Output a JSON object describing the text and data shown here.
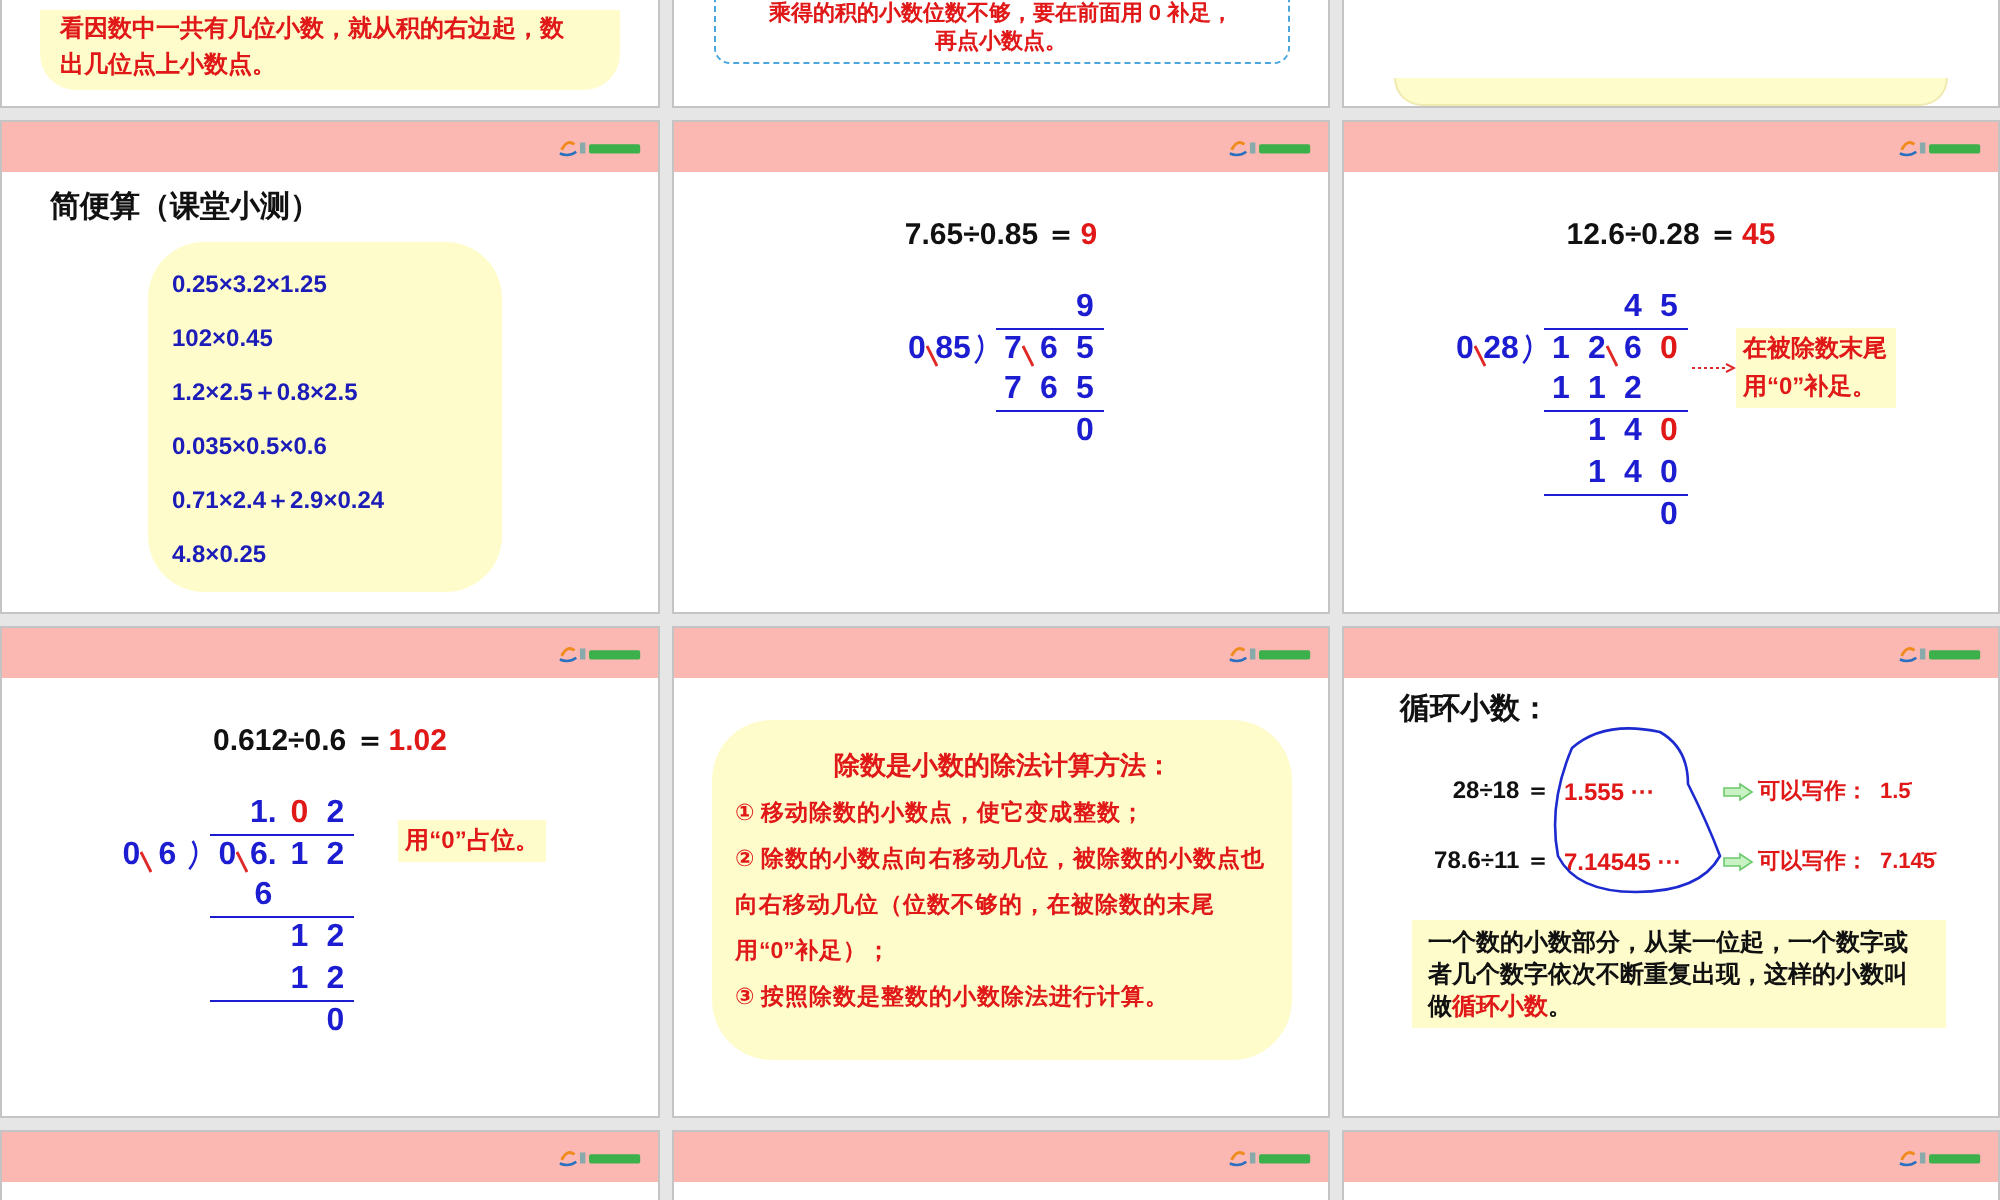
{
  "slide_rows": [
    {
      "slides": [
        {
          "kind": "note",
          "dashed_border": false,
          "lines": [
            "看因数中一共有几位小数，就从积的右边起，数",
            "出几位点上小数点。"
          ]
        },
        {
          "kind": "note",
          "dashed_border": true,
          "lines": [
            "乘得的积的小数位数不够，要在前面用 0 补足，",
            "再点小数点。"
          ]
        },
        {
          "kind": "note",
          "dashed_border": false
        }
      ]
    },
    {
      "slides": [
        {
          "kind": "practice",
          "title": "简便算（课堂小测）",
          "items": [
            "0.25×3.2×1.25",
            "102×0.45",
            "1.2×2.5＋0.8×2.5",
            "0.035×0.5×0.6",
            "0.71×2.4＋2.9×0.24",
            "4.8×0.25"
          ]
        },
        {
          "kind": "division",
          "equation": {
            "expression": "7.65÷0.85 ＝",
            "answer": "9"
          },
          "division": {
            "divisor": [
              {
                "t": "0",
                "struck": true
              },
              {
                "t": "85",
                "struck": false
              }
            ],
            "quotient": [
              {
                "kind": "blank"
              },
              {
                "kind": "blank"
              },
              {
                "kind": "digit",
                "t": "9",
                "highlight": false
              }
            ],
            "dividend": [
              {
                "t": "7",
                "struck": true,
                "highlight": false
              },
              {
                "t": "6",
                "struck": false,
                "highlight": false
              },
              {
                "t": "5",
                "struck": false,
                "highlight": false
              }
            ],
            "steps": [
              {
                "cells": [
                  {
                    "kind": "digit",
                    "t": "7",
                    "highlight": false
                  },
                  {
                    "kind": "digit",
                    "t": "6",
                    "highlight": false
                  },
                  {
                    "kind": "digit",
                    "t": "5",
                    "highlight": false
                  }
                ],
                "rule": true
              },
              {
                "cells": [
                  {
                    "kind": "blank"
                  },
                  {
                    "kind": "blank"
                  },
                  {
                    "kind": "digit",
                    "t": "0",
                    "highlight": false
                  }
                ],
                "rule": false
              }
            ]
          }
        },
        {
          "kind": "division",
          "equation": {
            "expression": "12.6÷0.28 ＝",
            "answer": "45"
          },
          "division": {
            "divisor": [
              {
                "t": "0",
                "struck": true
              },
              {
                "t": "28",
                "struck": false
              }
            ],
            "quotient": [
              {
                "kind": "blank"
              },
              {
                "kind": "blank"
              },
              {
                "kind": "digit",
                "t": "4",
                "highlight": false
              },
              {
                "kind": "digit",
                "t": "5",
                "highlight": false
              }
            ],
            "dividend": [
              {
                "t": "1",
                "struck": false,
                "highlight": false
              },
              {
                "t": "2",
                "struck": true,
                "highlight": false
              },
              {
                "t": "6",
                "struck": false,
                "highlight": false
              },
              {
                "t": "0",
                "struck": false,
                "highlight": true
              }
            ],
            "steps": [
              {
                "cells": [
                  {
                    "kind": "digit",
                    "t": "1",
                    "highlight": false
                  },
                  {
                    "kind": "digit",
                    "t": "1",
                    "highlight": false
                  },
                  {
                    "kind": "digit",
                    "t": "2",
                    "highlight": false
                  },
                  {
                    "kind": "blank"
                  }
                ],
                "rule": true
              },
              {
                "cells": [
                  {
                    "kind": "blank"
                  },
                  {
                    "kind": "digit",
                    "t": "1",
                    "highlight": false
                  },
                  {
                    "kind": "digit",
                    "t": "4",
                    "highlight": false
                  },
                  {
                    "kind": "digit",
                    "t": "0",
                    "highlight": true
                  }
                ],
                "rule": false
              },
              {
                "cells": [
                  {
                    "kind": "blank"
                  },
                  {
                    "kind": "digit",
                    "t": "1",
                    "highlight": false
                  },
                  {
                    "kind": "digit",
                    "t": "4",
                    "highlight": false
                  },
                  {
                    "kind": "digit",
                    "t": "0",
                    "highlight": false
                  }
                ],
                "rule": true
              },
              {
                "cells": [
                  {
                    "kind": "blank"
                  },
                  {
                    "kind": "blank"
                  },
                  {
                    "kind": "blank"
                  },
                  {
                    "kind": "digit",
                    "t": "0",
                    "highlight": false
                  }
                ],
                "rule": false
              }
            ]
          },
          "callout": {
            "lines": [
              "在被除数末尾",
              "用“0”补足。"
            ],
            "leader": true
          }
        }
      ]
    },
    {
      "slides": [
        {
          "kind": "division",
          "equation": {
            "expression": "0.612÷0.6 ＝",
            "answer": "1.02"
          },
          "division": {
            "divisor": [
              {
                "t": "0",
                "struck": true
              },
              {
                "t": "6",
                "struck": false
              }
            ],
            "quotient": [
              {
                "kind": "blank"
              },
              {
                "kind": "digit",
                "t": "1.",
                "highlight": false
              },
              {
                "kind": "digit",
                "t": "0",
                "highlight": true
              },
              {
                "kind": "digit",
                "t": "2",
                "highlight": false
              }
            ],
            "dividend": [
              {
                "t": "0",
                "struck": true,
                "highlight": false
              },
              {
                "t": "6.",
                "struck": false,
                "highlight": false
              },
              {
                "t": "1",
                "struck": false,
                "highlight": false
              },
              {
                "t": "2",
                "struck": false,
                "highlight": false
              }
            ],
            "steps": [
              {
                "cells": [
                  {
                    "kind": "blank"
                  },
                  {
                    "kind": "digit",
                    "t": "6",
                    "highlight": false
                  },
                  {
                    "kind": "blank"
                  },
                  {
                    "kind": "blank"
                  }
                ],
                "rule": true
              },
              {
                "cells": [
                  {
                    "kind": "blank"
                  },
                  {
                    "kind": "blank"
                  },
                  {
                    "kind": "digit",
                    "t": "1",
                    "highlight": false
                  },
                  {
                    "kind": "digit",
                    "t": "2",
                    "highlight": false
                  }
                ],
                "rule": false
              },
              {
                "cells": [
                  {
                    "kind": "blank"
                  },
                  {
                    "kind": "blank"
                  },
                  {
                    "kind": "digit",
                    "t": "1",
                    "highlight": false
                  },
                  {
                    "kind": "digit",
                    "t": "2",
                    "highlight": false
                  }
                ],
                "rule": true
              },
              {
                "cells": [
                  {
                    "kind": "blank"
                  },
                  {
                    "kind": "blank"
                  },
                  {
                    "kind": "blank"
                  },
                  {
                    "kind": "digit",
                    "t": "0",
                    "highlight": false
                  }
                ],
                "rule": false
              }
            ]
          },
          "callout": {
            "lines": [
              "用“0”占位。"
            ],
            "leader": false
          }
        },
        {
          "kind": "method",
          "title": "除数是小数的除法计算方法：",
          "items": [
            "① 移动除数的小数点，使它变成整数；",
            "② 除数的小数点向右移动几位，被除数的小数点也向右移动几位（位数不够的，在被除数的末尾用“0”补足）；",
            "③ 按照除数是整数的小数除法进行计算。"
          ]
        },
        {
          "kind": "repeating",
          "title": "循环小数：",
          "rows": [
            {
              "expression": "28÷18 ＝",
              "value": "1.555 ···",
              "note": "可以写作：",
              "result": "1.5̇"
            },
            {
              "expression": "78.6÷11 ＝",
              "value": "7.14545 ···",
              "note": "可以写作：",
              "result": "7.14̇5̇"
            }
          ],
          "definition": {
            "text": "一个数的小数部分，从某一位起，一个数字或者几个数字依次不断重复出现，这样的小数叫做",
            "term": "循环小数",
            "end": "。"
          }
        }
      ]
    },
    {
      "slides": [
        {
          "kind": "blank"
        },
        {
          "kind": "blank"
        },
        {
          "kind": "blank"
        }
      ]
    }
  ]
}
